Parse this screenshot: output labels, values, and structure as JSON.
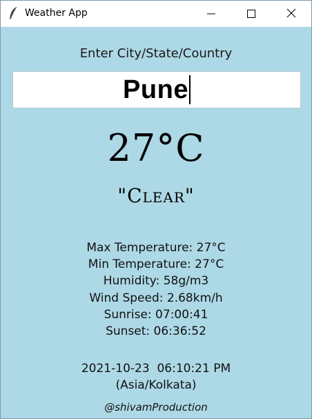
{
  "window": {
    "title": "Weather App",
    "icon": "feather-icon"
  },
  "search": {
    "prompt": "Enter City/State/Country",
    "value": "Pune"
  },
  "weather": {
    "temperature": "27°C",
    "condition": "\"Clear\""
  },
  "details": {
    "max_temperature": "Max Temperature: 27°C",
    "min_temperature": "Min Temperature: 27°C",
    "humidity": "Humidity: 58g/m3",
    "wind_speed": "Wind Speed: 2.68km/h",
    "sunrise": "Sunrise: 07:00:41",
    "sunset": "Sunset: 06:36:52"
  },
  "datetime": {
    "value": "2021-10-23  06:10:21 PM",
    "timezone": "(Asia/Kolkata)"
  },
  "footer": {
    "credit": "@shivamProduction"
  },
  "colors": {
    "background": "#add8e6",
    "titlebar": "#ffffff"
  }
}
